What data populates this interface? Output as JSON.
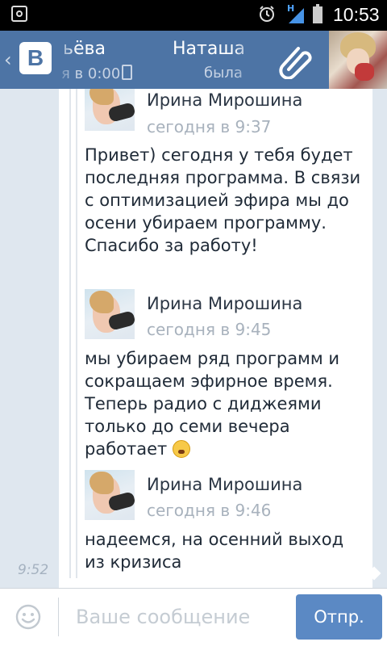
{
  "status_bar": {
    "time": "10:53",
    "network": "H",
    "icons": [
      "screenshot-icon",
      "alarm-icon",
      "signal-icon",
      "battery-icon"
    ]
  },
  "header": {
    "contact1_name": "ьёва",
    "contact1_status": "я в 0:00",
    "contact2_name": "Наташа",
    "contact2_status": "была",
    "icons": [
      "back-icon",
      "vk-logo",
      "attach-icon"
    ],
    "vk_letter": "В",
    "accent_color": "#4d74a5"
  },
  "conversation": {
    "message_time": "9:52",
    "forwarded": [
      {
        "author": "Ирина Мирошина",
        "date": "сегодня в 9:37",
        "text": "Привет) сегодня у тебя будет последняя программа. В связи с оптимизацией эфира мы до осени убираем программу. Спасибо за работу!"
      },
      {
        "author": "Ирина Мирошина",
        "date": "сегодня в 9:45",
        "text": "мы убираем ряд программ и сокращаем эфирное время. Теперь радио с диджеями только до семи вечера работает",
        "emoji": "weary-face-emoji"
      },
      {
        "author": "Ирина Мирошина",
        "date": "сегодня в 9:46",
        "text": "надеемся, на осенний выход из кризиса"
      }
    ]
  },
  "composer": {
    "placeholder": "Ваше сообщение",
    "value": "",
    "send_label": "Отпр.",
    "send_color": "#5b89c4"
  }
}
